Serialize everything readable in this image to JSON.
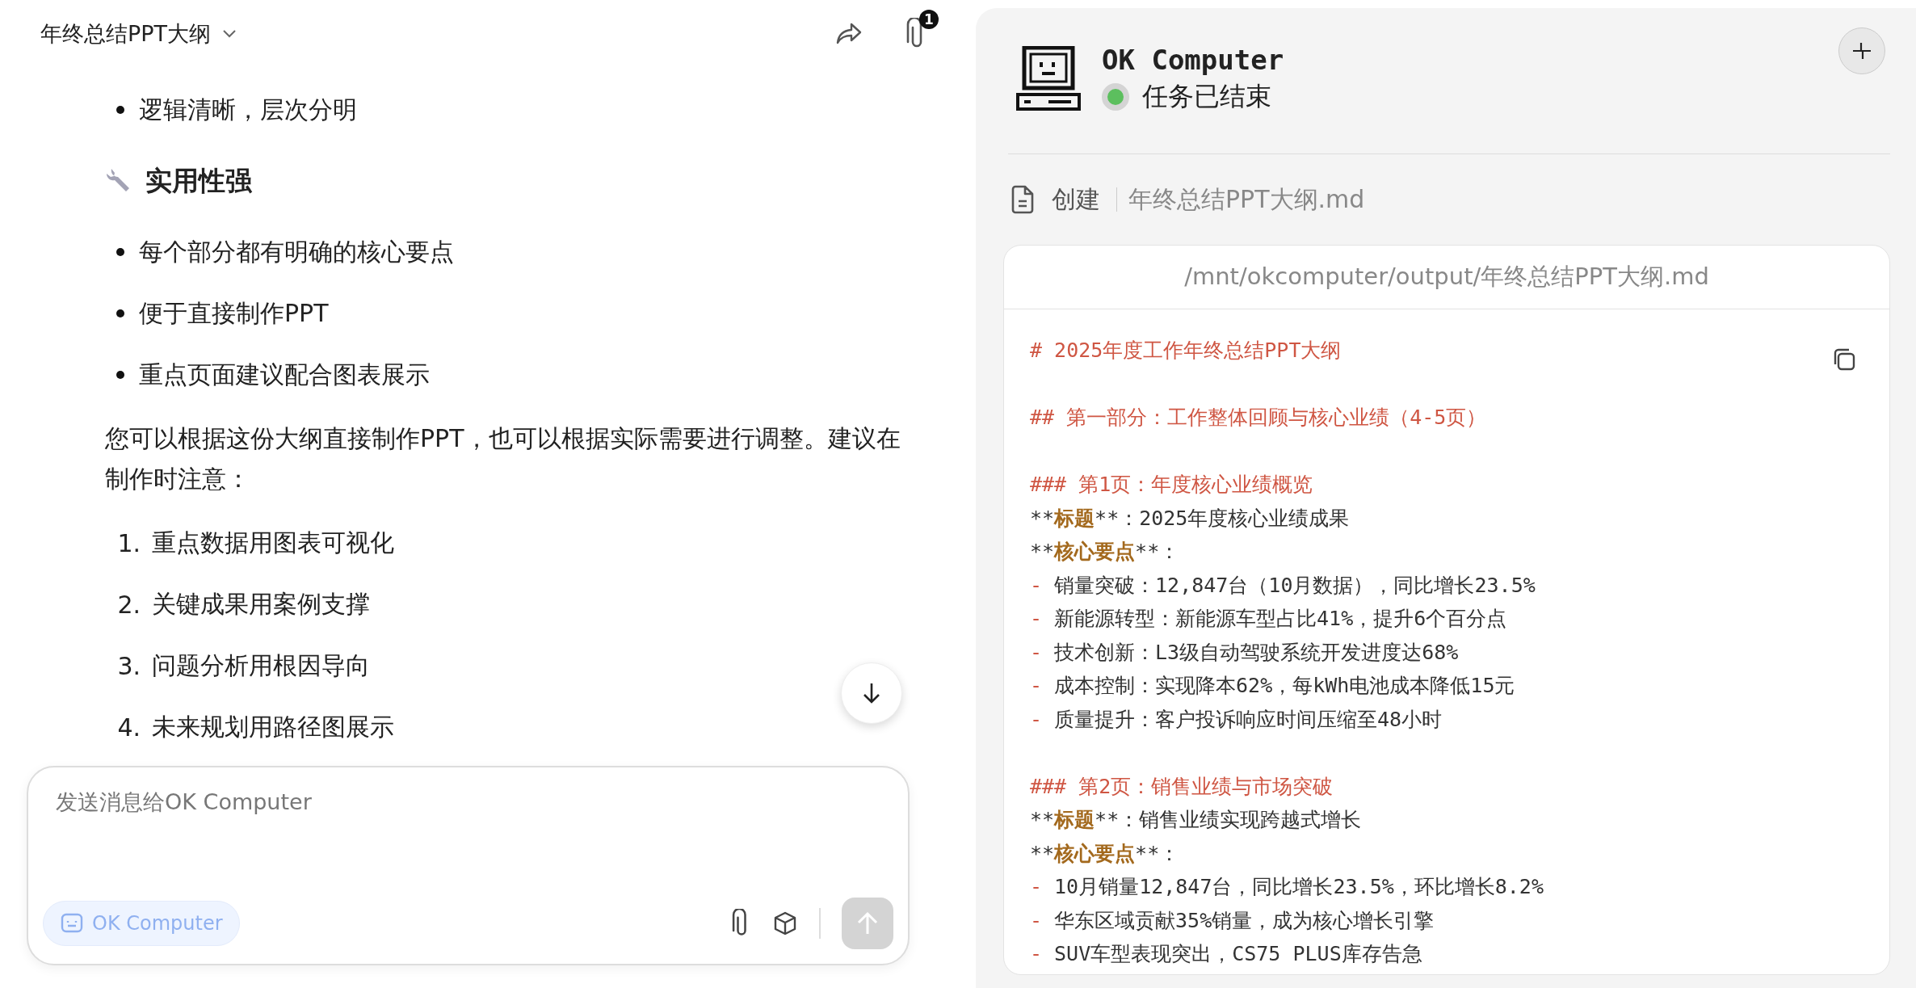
{
  "chat": {
    "title": "年终总结PPT大纲",
    "attachment_count": "1",
    "blocks": [
      {
        "kind": "bullet",
        "text": "逻辑清晰，层次分明"
      },
      {
        "kind": "heading",
        "text": "实用性强"
      },
      {
        "kind": "bullet",
        "text": "每个部分都有明确的核心要点"
      },
      {
        "kind": "bullet",
        "text": "便于直接制作PPT"
      },
      {
        "kind": "bullet",
        "text": "重点页面建议配合图表展示"
      },
      {
        "kind": "paragraph",
        "text": "您可以根据这份大纲直接制作PPT，也可以根据实际需要进行调整。建议在制作时注意："
      },
      {
        "kind": "numbered",
        "number": "1.",
        "text": "重点数据用图表可视化"
      },
      {
        "kind": "numbered",
        "number": "2.",
        "text": "关键成果用案例支撑"
      },
      {
        "kind": "numbered",
        "number": "3.",
        "text": "问题分析用根因导向"
      },
      {
        "kind": "numbered",
        "number": "4.",
        "text": "未来规划用路径图展示"
      }
    ],
    "composer": {
      "placeholder": "发送消息给OK Computer",
      "mode_chip": {
        "label": "OK Computer",
        "selected": true
      },
      "send_disabled": true
    }
  },
  "panel": {
    "agent_name": "OK Computer",
    "status": {
      "text": "任务已结束",
      "done": true
    },
    "action": "创建",
    "filename": "年终总结PPT大纲.md",
    "file_path": "/mnt/okcomputer/output/年终总结PPT大纲.md",
    "lines": [
      {
        "kind": "heading",
        "hashes": "#",
        "text": "2025年度工作年终总结PPT大纲"
      },
      {
        "kind": "blank"
      },
      {
        "kind": "heading",
        "hashes": "##",
        "text": "第一部分：工作整体回顾与核心业绩（4-5页）"
      },
      {
        "kind": "blank"
      },
      {
        "kind": "heading",
        "hashes": "###",
        "text": "第1页：年度核心业绩概览"
      },
      {
        "kind": "field",
        "open": "**",
        "label": "标题",
        "close": "**",
        "value": "：2025年度核心业绩成果"
      },
      {
        "kind": "field",
        "open": "**",
        "label": "核心要点",
        "close": "**",
        "value": "："
      },
      {
        "kind": "bullet",
        "dash": "-",
        "text": "销量突破：12,847台（10月数据），同比增长23.5%"
      },
      {
        "kind": "bullet",
        "dash": "-",
        "text": "新能源转型：新能源车型占比41%，提升6个百分点"
      },
      {
        "kind": "bullet",
        "dash": "-",
        "text": "技术创新：L3级自动驾驶系统开发进度达68%"
      },
      {
        "kind": "bullet",
        "dash": "-",
        "text": "成本控制：实现降本62%，每kWh电池成本降低15元"
      },
      {
        "kind": "bullet",
        "dash": "-",
        "text": "质量提升：客户投诉响应时间压缩至48小时"
      },
      {
        "kind": "blank"
      },
      {
        "kind": "heading",
        "hashes": "###",
        "text": "第2页：销售业绩与市场突破"
      },
      {
        "kind": "field",
        "open": "**",
        "label": "标题",
        "close": "**",
        "value": "：销售业绩实现跨越式增长"
      },
      {
        "kind": "field",
        "open": "**",
        "label": "核心要点",
        "close": "**",
        "value": "："
      },
      {
        "kind": "bullet",
        "dash": "-",
        "text": "10月销量12,847台，同比增长23.5%，环比增长8.2%"
      },
      {
        "kind": "bullet",
        "dash": "-",
        "text": "华东区域贡献35%销量，成为核心增长引擎"
      },
      {
        "kind": "bullet",
        "dash": "-",
        "text": "SUV车型表现突出，CS75 PLUS库存告急"
      }
    ]
  }
}
